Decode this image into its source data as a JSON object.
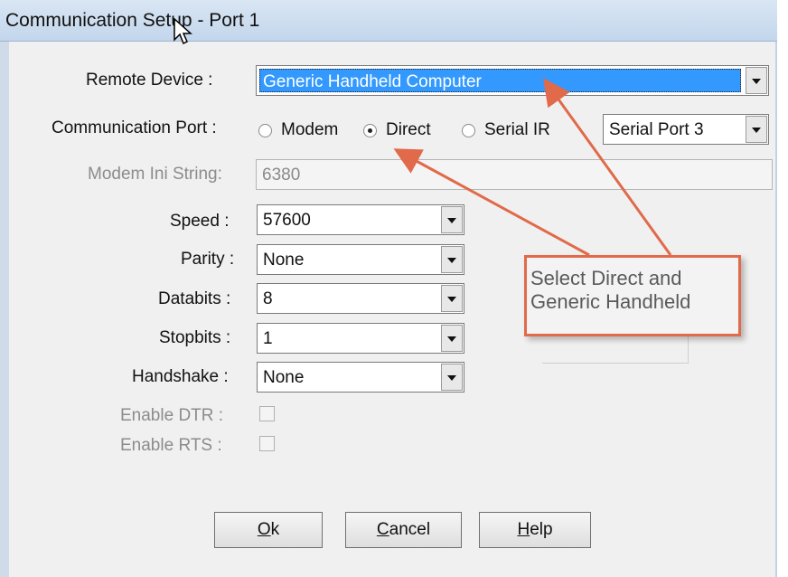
{
  "window": {
    "title": "Communication Setup - Port 1"
  },
  "fields": {
    "remote_device": {
      "label": "Remote Device :",
      "value": "Generic Handheld Computer"
    },
    "comm_port": {
      "label": "Communication Port :",
      "options": [
        "Modem",
        "Direct",
        "Serial IR"
      ],
      "selected": "Direct",
      "port_value": "Serial Port 3"
    },
    "modem_ini": {
      "label": "Modem Ini String:",
      "value": "6380"
    },
    "speed": {
      "label": "Speed :",
      "value": "57600"
    },
    "parity": {
      "label": "Parity :",
      "value": "None"
    },
    "databits": {
      "label": "Databits :",
      "value": "8"
    },
    "stopbits": {
      "label": "Stopbits :",
      "value": "1"
    },
    "handshake": {
      "label": "Handshake :",
      "value": "None"
    },
    "enable_dtr": {
      "label": "Enable DTR :",
      "checked": false
    },
    "enable_rts": {
      "label": "Enable RTS :",
      "checked": false
    }
  },
  "buttons": {
    "ok": {
      "mnemonic": "O",
      "rest": "k"
    },
    "cancel": {
      "mnemonic": "C",
      "rest": "ancel"
    },
    "help": {
      "mnemonic": "H",
      "rest": "elp"
    }
  },
  "annotation": {
    "line1": "Select Direct and",
    "line2": "Generic Handheld",
    "color": "#e06a4a"
  },
  "icons": {
    "cursor": "mouse-pointer-icon",
    "dropdown": "chevron-down-icon"
  }
}
